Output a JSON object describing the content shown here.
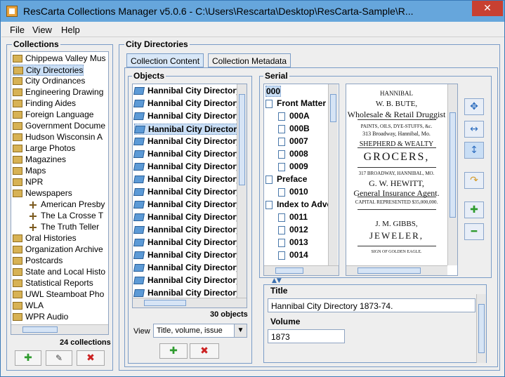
{
  "window": {
    "title": "ResCarta Collections Manager v5.0.6 - C:\\Users\\Rescarta\\Desktop\\ResCarta-Sample\\R...",
    "close_label": "✕"
  },
  "menu": [
    "File",
    "View",
    "Help"
  ],
  "collections": {
    "label": "Collections",
    "items": [
      {
        "label": "Chippewa Valley Mus",
        "indent": 0
      },
      {
        "label": "City Directories",
        "indent": 0
      },
      {
        "label": "City Ordinances",
        "indent": 0
      },
      {
        "label": "Engineering Drawing",
        "indent": 0
      },
      {
        "label": "Finding Aides",
        "indent": 0
      },
      {
        "label": "Foreign Language",
        "indent": 0
      },
      {
        "label": "Government Docume",
        "indent": 0
      },
      {
        "label": "Hudson Wisconsin A",
        "indent": 0
      },
      {
        "label": "Large Photos",
        "indent": 0
      },
      {
        "label": "Magazines",
        "indent": 0
      },
      {
        "label": "Maps",
        "indent": 0
      },
      {
        "label": "NPR",
        "indent": 0
      },
      {
        "label": "Newspapers",
        "indent": 0
      },
      {
        "label": "American Presby",
        "indent": 1
      },
      {
        "label": "The La Crosse T",
        "indent": 1
      },
      {
        "label": "The Truth Teller",
        "indent": 1
      },
      {
        "label": "Oral Histories",
        "indent": 0
      },
      {
        "label": "Organization Archive",
        "indent": 0
      },
      {
        "label": "Postcards",
        "indent": 0
      },
      {
        "label": "State and Local Histo",
        "indent": 0
      },
      {
        "label": "Statistical Reports",
        "indent": 0
      },
      {
        "label": "UWL Steamboat Pho",
        "indent": 0
      },
      {
        "label": "WLA",
        "indent": 0
      },
      {
        "label": "WPR Audio",
        "indent": 0
      }
    ],
    "count": "24 collections"
  },
  "tabs": {
    "group_label": "City Directories",
    "content": "Collection Content",
    "metadata": "Collection Metadata"
  },
  "objects": {
    "label": "Objects",
    "items": [
      "Hannibal City Directory",
      "Hannibal City Directory",
      "Hannibal City Directory",
      "Hannibal City Directory",
      "Hannibal City Directory",
      "Hannibal City Directory",
      "Hannibal City Directory",
      "Hannibal City Directory",
      "Hannibal City Directory",
      "Hannibal City Directory",
      "Hannibal City Directory",
      "Hannibal City Directory",
      "Hannibal City Directory",
      "Hannibal City Directory",
      "Hannibal City Directory",
      "Hannibal City Directory",
      "Hannibal City Directory"
    ],
    "count": "30 objects",
    "view_label": "View",
    "view_value": "Title, volume, issue"
  },
  "serial": {
    "label": "Serial",
    "tree": [
      {
        "label": "000",
        "type": "root"
      },
      {
        "label": "Front Matter",
        "type": "folder"
      },
      {
        "label": "000A",
        "type": "page"
      },
      {
        "label": "000B",
        "type": "page"
      },
      {
        "label": "0007",
        "type": "page"
      },
      {
        "label": "0008",
        "type": "page"
      },
      {
        "label": "0009",
        "type": "page"
      },
      {
        "label": "Preface",
        "type": "folder"
      },
      {
        "label": "0010",
        "type": "page"
      },
      {
        "label": "Index to Adve",
        "type": "folder"
      },
      {
        "label": "0011",
        "type": "page"
      },
      {
        "label": "0012",
        "type": "page"
      },
      {
        "label": "0013",
        "type": "page"
      },
      {
        "label": "0014",
        "type": "page"
      }
    ],
    "page_lines": [
      "HANNIBAL",
      "W. B. BUTE,",
      "Wholesale & Retail Druggist",
      "PAINTS, OILS, DYE-STUFFS, &c.",
      "313 Broadway,     Hannibal, Mo.",
      "SHEPHERD & WEALTY",
      "GROCERS,",
      "317 BROADWAY, HANNIBAL, MO.",
      "G. W. HEWITT,",
      "General Insurance Agent.",
      "CAPITAL REPRESENTED $35,000,000.",
      "J. M. GIBBS,",
      "JEWELER,",
      "SIGN OF GOLDEN EAGLE."
    ]
  },
  "metadata": {
    "title_label": "Title",
    "title_value": "Hannibal City Directory 1873-74.",
    "volume_label": "Volume",
    "volume_value": "1873"
  }
}
